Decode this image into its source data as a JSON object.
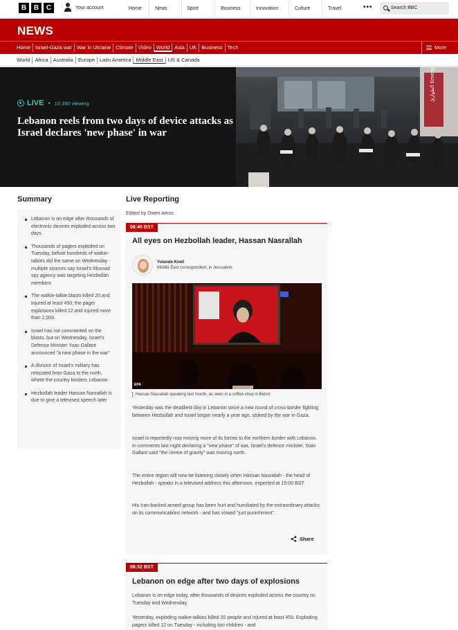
{
  "topbar": {
    "logo_letters": [
      "B",
      "B",
      "C"
    ],
    "account_label": "Your account",
    "nav": [
      "Home",
      "News",
      "Sport",
      "Business",
      "Innovation",
      "Culture",
      "Travel"
    ],
    "more_label": "•••",
    "search_label": "Search BBC"
  },
  "newsbar": {
    "title": "NEWS",
    "sections": [
      "Home",
      "Israel-Gaza war",
      "War in Ukraine",
      "Climate",
      "Video",
      "World",
      "Asia",
      "UK",
      "Business",
      "Tech"
    ],
    "active_section": "World",
    "more_label": "More"
  },
  "subnav": {
    "items": [
      "World",
      "Africa",
      "Australia",
      "Europe",
      "Latin America",
      "Middle East",
      "US & Canada"
    ],
    "active_item": "Middle East"
  },
  "hero": {
    "live_label": "LIVE",
    "live_separator": "•",
    "viewing": "10,390 viewing",
    "title": "Lebanon reels from two days of device attacks as Israel declares 'new phase' in war",
    "photo_sign": "الطوارئ Emergency"
  },
  "summary": {
    "heading": "Summary",
    "items": [
      "Lebanon is on edge after thousands of electronic devices exploded across two days",
      "Thousands of pagers exploded on Tuesday, before hundreds of walkie-talkies did the same on Wednesday - multiple sources say Israel's Mossad spy agency was targeting Hezbollah members",
      "The walkie-talkie blasts killed 20 and injured at least 450; the pager explosions killed 12 and injured more than 2,000",
      "Israel has not commented on the blasts, but on Wednesday, Israel's Defence Minister Yoav Gallant announced \"a new phase in the war\"",
      "A division of Israel's military has relocated from Gaza to the north, where the country borders Lebanon",
      "Hezbollah leader Hassan Nasrallah is due to give a televised speech later"
    ]
  },
  "live": {
    "heading": "Live Reporting",
    "edited_by": "Edited by Owen Amos",
    "posts": [
      {
        "time": "06:40 BST",
        "title": "All eyes on Hezbollah leader, Hassan Nasrallah",
        "author_name": "Yolande Knell",
        "author_role": "Middle East correspondent, in Jerusalem",
        "image_credit": "EPA",
        "caption": "Hassan Nasrallah speaking last month, as seen in a coffee shop in Beirut",
        "paragraphs": [
          "Yesterday was the deadliest day in Lebanon since a new round of cross-border fighting between Hezbollah and Israel began nearly a year ago, stoked by the war in Gaza.",
          "Israel is reportedly now moving more of its forces to the northern border with Lebanon. In comments last night declaring a \"new phase\" of war, Israel's defence minister, Yoav Gallant said \"the centre of gravity\" was moving north.",
          "The entire region will now be listening closely when Hassan Nasrallah - the head of Hezbollah - speaks in a televised address this afternoon, expected at 15:00 BST.",
          "His Iran-backed armed group has been hurt and humiliated by the extraordinary attacks on its communications network - and has vowed \"just punishment\"."
        ],
        "share_label": "Share"
      },
      {
        "time": "06:32 BST",
        "title": "Lebanon on edge after two days of explosions",
        "paragraphs": [
          "Lebanon is on edge today, after thousands of devices exploded across the country on Tuesday and Wednesday.",
          "Yesterday, exploding walkie-talkies killed 20 people and injured at least 450. Exploding pagers killed 12 on Tuesday - including two children - and"
        ]
      }
    ]
  },
  "colors": {
    "brand_red": "#b80000",
    "live_teal": "#3fc9c0",
    "hero_bg": "#141414",
    "panel_bg": "#f6f6f6"
  }
}
